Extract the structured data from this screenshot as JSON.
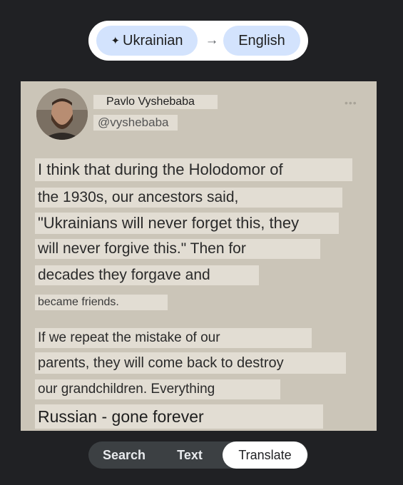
{
  "translation": {
    "source_language": "Ukrainian",
    "target_language": "English",
    "sparkle_icon": "sparkle-icon",
    "arrow_icon": "arrow-right-icon"
  },
  "post": {
    "author_name": "Pavlo Vyshebaba",
    "author_handle": "@vyshebaba",
    "more_icon": "more-dots-icon",
    "lines": [
      "I think that during the Holodomor of",
      "the 1930s, our ancestors said,",
      "\"Ukrainians will never forget this, they",
      "will never forgive this.\" Then for",
      "decades they forgave and",
      "became friends.",
      "If we repeat the mistake of our",
      "parents, they will come back to destroy",
      "our grandchildren. Everything",
      "Russian - gone forever"
    ]
  },
  "modes": {
    "search": "Search",
    "text": "Text",
    "translate": "Translate",
    "selected": "Translate"
  },
  "colors": {
    "background": "#202124",
    "chip": "#d3e3fd",
    "photo_background": "#cbc5b8"
  }
}
